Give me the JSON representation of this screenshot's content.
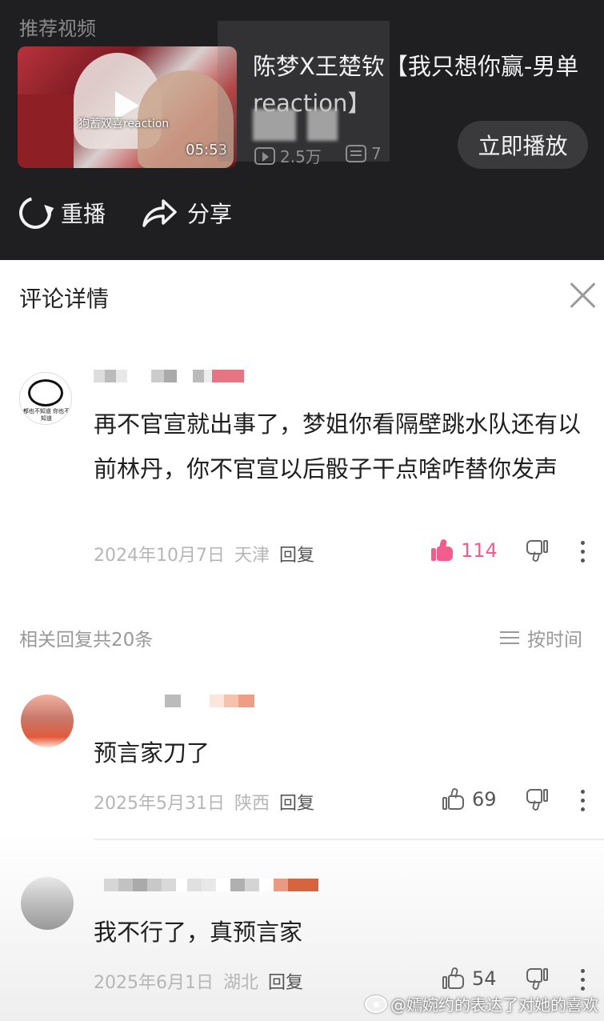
{
  "recommended": {
    "label": "推荐视频",
    "video": {
      "title": "陈梦X王楚钦【我只想你赢-男单",
      "title_line2": "reaction】",
      "thumbnail_watermark": "狗蓄双喜reaction",
      "duration": "05:53",
      "views": "2.5万",
      "comments": "7"
    },
    "play_now_label": "立即播放"
  },
  "actions": {
    "replay_label": "重播",
    "share_label": "分享"
  },
  "panel": {
    "title": "评论详情"
  },
  "main_comment": {
    "avatar_caption": "都也不知道 你也不知道",
    "text": "再不官宣就出事了，梦姐你看隔壁跳水队还有以前林丹，你不官宣以后骰子干点啥咋替你发声",
    "date": "2024年10月7日",
    "location": "天津",
    "reply_label": "回复",
    "likes": "114",
    "liked": true
  },
  "replies_header": {
    "count_label": "相关回复共20条",
    "sort_label": "按时间"
  },
  "replies": [
    {
      "text": "预言家刀了",
      "date": "2025年5月31日",
      "location": "陕西",
      "reply_label": "回复",
      "likes": "69"
    },
    {
      "text": "我不行了，真预言家",
      "date": "2025年6月1日",
      "location": "湖北",
      "reply_label": "回复",
      "likes": "54"
    }
  ],
  "watermark": "@嫣婉约的表达了对她的喜欢",
  "colors": {
    "top_bg": "#1f1f21",
    "like_active": "#f25d8e",
    "muted_text": "#b6b6b6"
  }
}
